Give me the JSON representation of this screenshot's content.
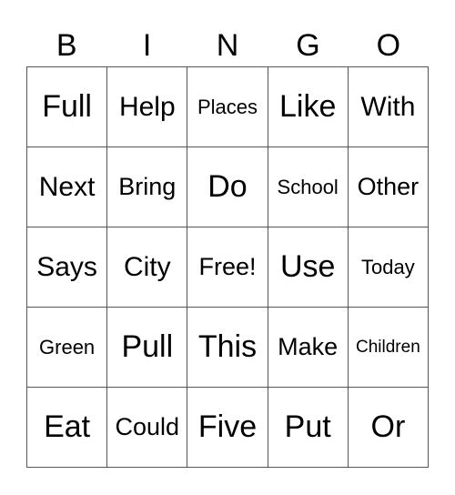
{
  "header": [
    "B",
    "I",
    "N",
    "G",
    "O"
  ],
  "cells": [
    [
      "Full",
      "Help",
      "Places",
      "Like",
      "With"
    ],
    [
      "Next",
      "Bring",
      "Do",
      "School",
      "Other"
    ],
    [
      "Says",
      "City",
      "Free!",
      "Use",
      "Today"
    ],
    [
      "Green",
      "Pull",
      "This",
      "Make",
      "Children"
    ],
    [
      "Eat",
      "Could",
      "Five",
      "Put",
      "Or"
    ]
  ]
}
